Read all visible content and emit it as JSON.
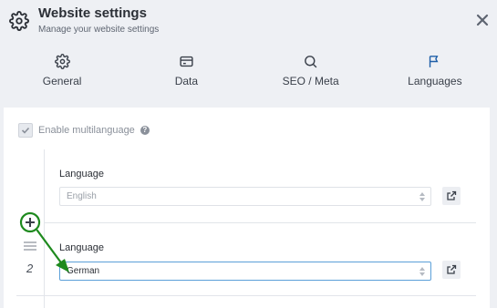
{
  "header": {
    "title": "Website settings",
    "subtitle": "Manage your website settings"
  },
  "tabs": [
    {
      "label": "General",
      "icon": "gear-icon"
    },
    {
      "label": "Data",
      "icon": "card-icon"
    },
    {
      "label": "SEO / Meta",
      "icon": "search-icon"
    },
    {
      "label": "Languages",
      "icon": "flag-icon"
    }
  ],
  "active_tab": "Languages",
  "multilanguage": {
    "label": "Enable multilanguage",
    "checked": true
  },
  "languages": [
    {
      "label": "Language",
      "value": "English",
      "disabled": true
    },
    {
      "label": "Language",
      "value": "German",
      "disabled": false,
      "index": "2"
    }
  ],
  "colors": {
    "header_bg": "#eef0f4",
    "panel_bg": "#ffffff",
    "annotation_green": "#1e8a1e",
    "focus_border": "#5b9fd8"
  }
}
